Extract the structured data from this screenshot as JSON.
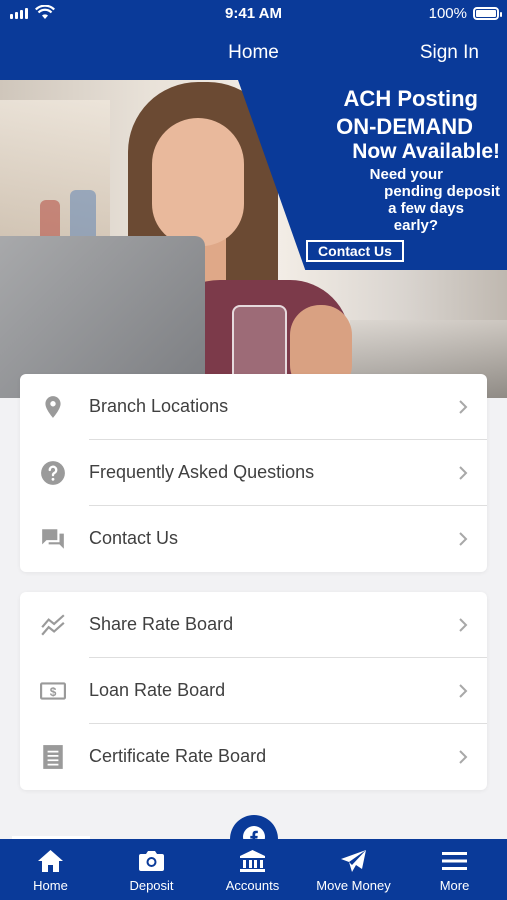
{
  "status_bar": {
    "time": "9:41 AM",
    "battery": "100%"
  },
  "header": {
    "title": "Home",
    "sign_in": "Sign In"
  },
  "banner": {
    "line1": "ACH Posting",
    "line2": "ON-DEMAND",
    "line3": "Now Available!",
    "question1": "Need your",
    "question2": "pending deposit",
    "question3": "a few days",
    "question4": "early?",
    "cta": "Contact Us"
  },
  "menu_group_1": [
    {
      "label": "Branch Locations",
      "icon": "location-pin-icon"
    },
    {
      "label": "Frequently Asked Questions",
      "icon": "help-circle-icon"
    },
    {
      "label": "Contact Us",
      "icon": "chat-bubbles-icon"
    }
  ],
  "menu_group_2": [
    {
      "label": "Share Rate Board",
      "icon": "trend-chart-icon"
    },
    {
      "label": "Loan Rate Board",
      "icon": "dollar-bill-icon"
    },
    {
      "label": "Certificate Rate Board",
      "icon": "document-icon"
    }
  ],
  "tabs": [
    {
      "label": "Home",
      "icon": "home-icon"
    },
    {
      "label": "Deposit",
      "icon": "camera-icon"
    },
    {
      "label": "Accounts",
      "icon": "bank-icon"
    },
    {
      "label": "Move Money",
      "icon": "paper-plane-icon"
    },
    {
      "label": "More",
      "icon": "menu-icon"
    }
  ],
  "colors": {
    "brand_blue": "#0a3a99",
    "text": "#404040",
    "icon_gray": "#9a9a9a"
  }
}
